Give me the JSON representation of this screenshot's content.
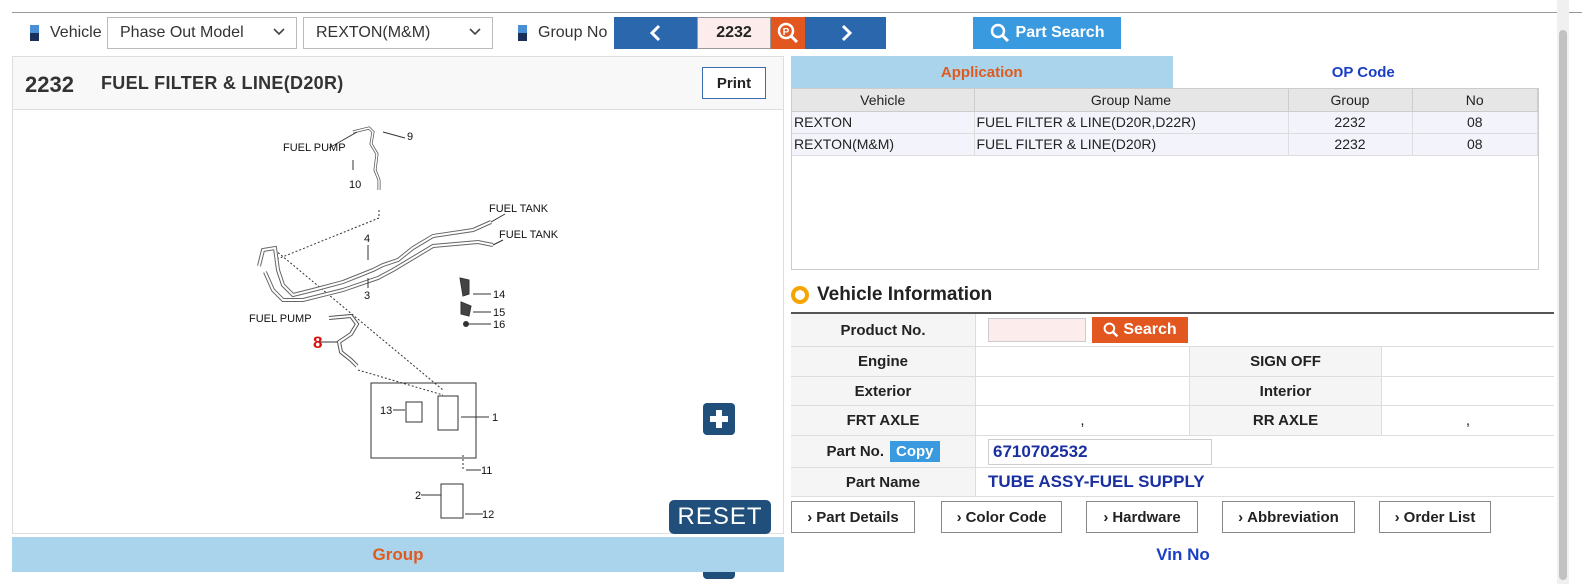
{
  "toolbar": {
    "vehicle_label": "Vehicle",
    "model_select": "Phase Out Model",
    "vehicle_select": "REXTON(M&M)",
    "group_no_label": "Group No",
    "group_no_value": "2232",
    "part_search_label": "Part Search"
  },
  "left": {
    "group_number": "2232",
    "group_title": "FUEL FILTER & LINE(D20R)",
    "print_label": "Print",
    "reset_label": "RESET",
    "diagram_labels": {
      "fuel_pump_top": "FUEL PUMP",
      "fuel_pump_mid": "FUEL PUMP",
      "fuel_tank_1": "FUEL TANK",
      "fuel_tank_2": "FUEL TANK",
      "n9": "9",
      "n10": "10",
      "n4": "4",
      "n3": "3",
      "n14": "14",
      "n15": "15",
      "n16": "16",
      "n8": "8",
      "n13": "13",
      "n1": "1",
      "n11": "11",
      "n2": "2",
      "n12": "12"
    }
  },
  "tabs": {
    "application": "Application",
    "op_code": "OP Code"
  },
  "app_table": {
    "headers": [
      "Vehicle",
      "Group Name",
      "Group",
      "No"
    ],
    "rows": [
      [
        "REXTON",
        "FUEL FILTER & LINE(D20R,D22R)",
        "2232",
        "08"
      ],
      [
        "REXTON(M&M)",
        "FUEL FILTER & LINE(D20R)",
        "2232",
        "08"
      ]
    ]
  },
  "vehicle_info": {
    "title": "Vehicle Information",
    "product_no_label": "Product No.",
    "search_label": "Search",
    "engine_label": "Engine",
    "sign_off_label": "SIGN OFF",
    "exterior_label": "Exterior",
    "interior_label": "Interior",
    "frt_axle_label": "FRT AXLE",
    "frt_axle_value": ",",
    "rr_axle_label": "RR AXLE",
    "rr_axle_value": ",",
    "part_no_label": "Part No.",
    "copy_label": "Copy",
    "part_no_value": "6710702532",
    "part_name_label": "Part Name",
    "part_name_value": "TUBE ASSY-FUEL SUPPLY"
  },
  "actions": {
    "part_details": "Part Details",
    "color_code": "Color Code",
    "hardware": "Hardware",
    "abbreviation": "Abbreviation",
    "order_list": "Order List"
  },
  "bottom": {
    "group": "Group",
    "vin_no": "Vin No"
  }
}
